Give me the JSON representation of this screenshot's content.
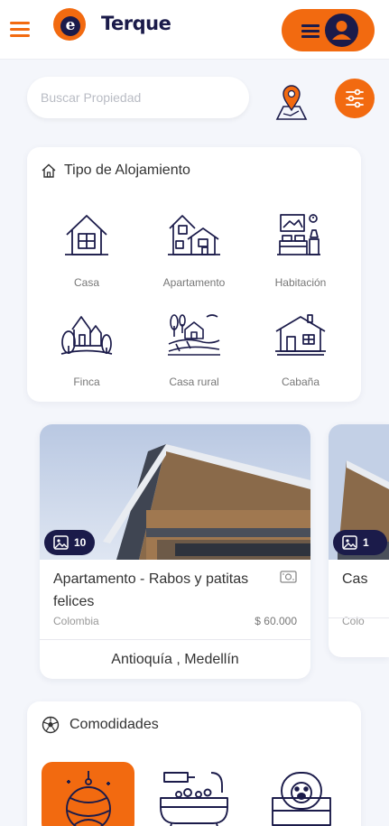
{
  "header": {
    "logo_letter": "e",
    "brand": "Terque",
    "accent_color": "#f26a10",
    "navy_color": "#1b1b4a",
    "menu_icon": "hamburger-icon",
    "profile_icon": "user-icon"
  },
  "search": {
    "placeholder": "Buscar Propiedad",
    "value": "",
    "location_icon": "map-pin-icon",
    "filter_icon": "sliders-icon"
  },
  "accommodation": {
    "title": "Tipo de Alojamiento",
    "title_icon": "home-outline-icon",
    "types": [
      {
        "label": "Casa",
        "icon": "house-icon"
      },
      {
        "label": "Apartamento",
        "icon": "apartment-icon"
      },
      {
        "label": "Habitación",
        "icon": "room-icon"
      },
      {
        "label": "Finca",
        "icon": "farm-icon"
      },
      {
        "label": "Casa rural",
        "icon": "rural-house-icon"
      },
      {
        "label": "Cabaña",
        "icon": "cabin-icon"
      }
    ]
  },
  "properties": [
    {
      "photo_count": "10",
      "title": "Apartamento - Rabos y patitas felices",
      "country": "Colombia",
      "price": "$ 60.000",
      "location": "Antioquía , Medellín"
    },
    {
      "photo_count": "1",
      "title": "Cas",
      "country": "Colo"
    }
  ],
  "amenities": {
    "title": "Comodidades",
    "title_icon": "soccer-ball-icon",
    "items": [
      {
        "icon": "pet-toy-icon",
        "active": true
      },
      {
        "icon": "pet-bath-icon",
        "active": false
      },
      {
        "icon": "pet-bed-icon",
        "active": false
      }
    ]
  }
}
